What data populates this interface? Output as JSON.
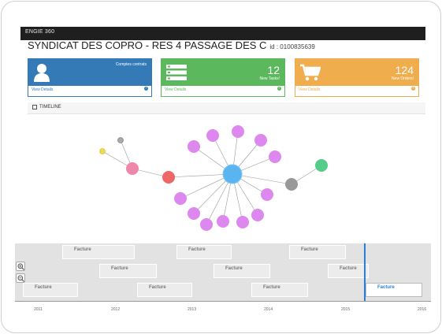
{
  "app": {
    "title": "ENGIE 360"
  },
  "page": {
    "title": "SYNDICAT DES COPRO - RES 4 PASSAGE DES C",
    "id_text": "id : 0100835639"
  },
  "cards": [
    {
      "icon": "user-icon",
      "number": "",
      "label": "Comptes contrats",
      "link": "View Details",
      "color": "#337ab7"
    },
    {
      "icon": "list-icon",
      "number": "12",
      "label": "New Tasks!",
      "link": "View Details",
      "color": "#5cb85c"
    },
    {
      "icon": "cart-icon",
      "number": "124",
      "label": "New Orders!",
      "link": "View Details",
      "color": "#f0ad4e"
    }
  ],
  "timeline": {
    "header": "TIMELINE",
    "events": [
      "Facture",
      "Facture",
      "Facture",
      "Facture",
      "Facture",
      "Facture",
      "Facture",
      "Facture",
      "Facture",
      "Facture"
    ],
    "selected_event": "Facture",
    "years": [
      "2011",
      "2012",
      "2013",
      "2014",
      "2015",
      "2016"
    ]
  },
  "graph": {
    "colors": {
      "hub": "#5ab4f0",
      "leaf": "#dd88ee",
      "red": "#ee6666",
      "pink": "#ee88aa",
      "gray": "#999999",
      "green": "#55cc88",
      "yellow": "#eedd44",
      "small_gray": "#aaaaaa"
    }
  }
}
